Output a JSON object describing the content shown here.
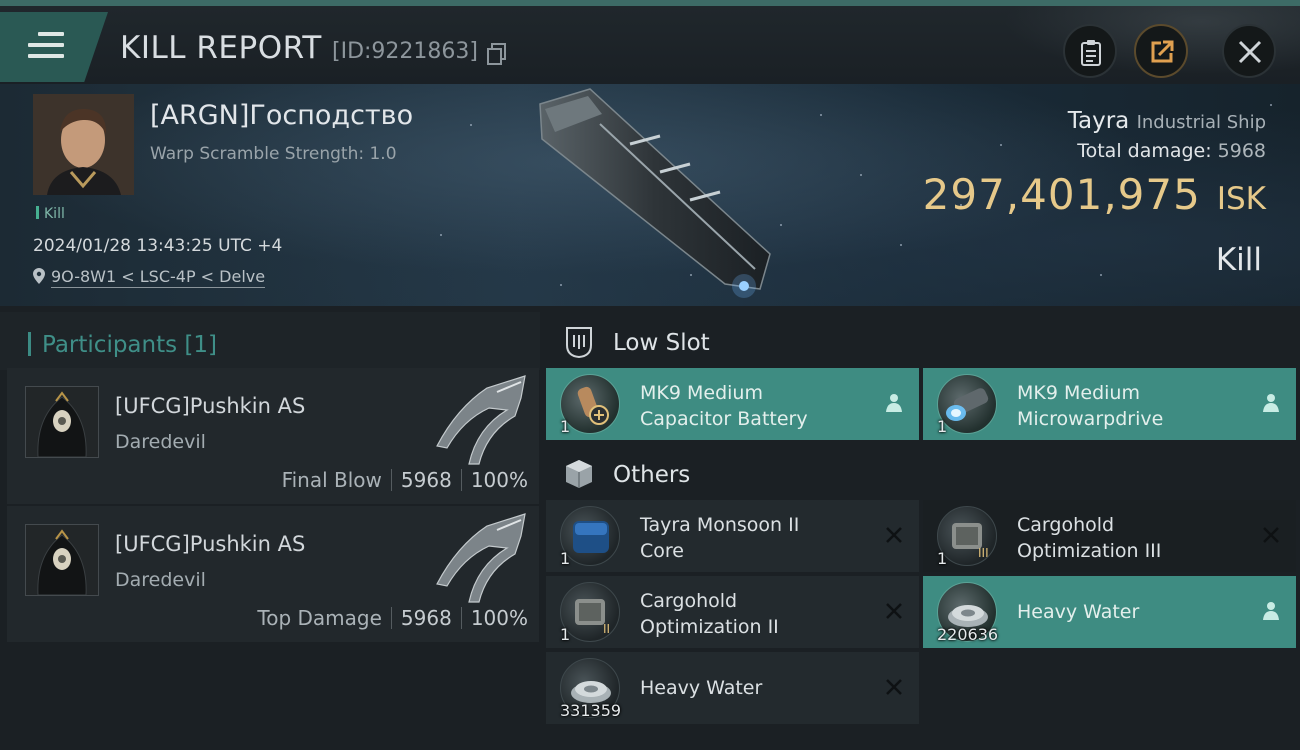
{
  "header": {
    "title": "KILL REPORT",
    "kill_id": "[ID:9221863]"
  },
  "victim": {
    "name": "[ARGN]Господство",
    "warp_scramble": "Warp Scramble Strength: 1.0",
    "kill_tag": "Kill",
    "timestamp": "2024/01/28 13:43:25 UTC +4",
    "location": "9O-8W1 < LSC-4P < Delve",
    "ship_name": "Tayra",
    "ship_class": "Industrial Ship",
    "total_damage_label": "Total damage:",
    "total_damage": "5968",
    "isk_value": "297,401,975",
    "isk_unit": "ISK",
    "result": "Kill"
  },
  "participants": {
    "label": "Participants",
    "count": "[1]",
    "rows": [
      {
        "name": "[UFCG]Pushkin AS",
        "ship": "Daredevil",
        "role": "Final Blow",
        "damage": "5968",
        "percent": "100%"
      },
      {
        "name": "[UFCG]Pushkin AS",
        "ship": "Daredevil",
        "role": "Top Damage",
        "damage": "5968",
        "percent": "100%"
      }
    ]
  },
  "fitting": {
    "low_slot_label": "Low Slot",
    "others_label": "Others",
    "low_slot": [
      {
        "line1": "MK9 Medium",
        "line2": "Capacitor Battery",
        "qty": "1",
        "status": "dropped"
      },
      {
        "line1": "MK9 Medium",
        "line2": "Microwarpdrive",
        "qty": "1",
        "status": "dropped"
      }
    ],
    "others": [
      {
        "line1": "Tayra Monsoon II",
        "line2": "Core",
        "qty": "1",
        "status": "destroyed"
      },
      {
        "line1": "Cargohold",
        "line2": "Optimization III",
        "qty": "1",
        "status": "destroyed"
      },
      {
        "line1": "Cargohold",
        "line2": "Optimization II",
        "qty": "1",
        "status": "destroyed"
      },
      {
        "line1": "Heavy Water",
        "line2": "",
        "qty": "220636",
        "status": "dropped"
      },
      {
        "line1": "Heavy Water",
        "line2": "",
        "qty": "331359",
        "status": "destroyed"
      }
    ]
  },
  "colors": {
    "accent_teal": "#3e8c82",
    "isk_gold": "#e6c98a",
    "background": "#1b2024"
  }
}
